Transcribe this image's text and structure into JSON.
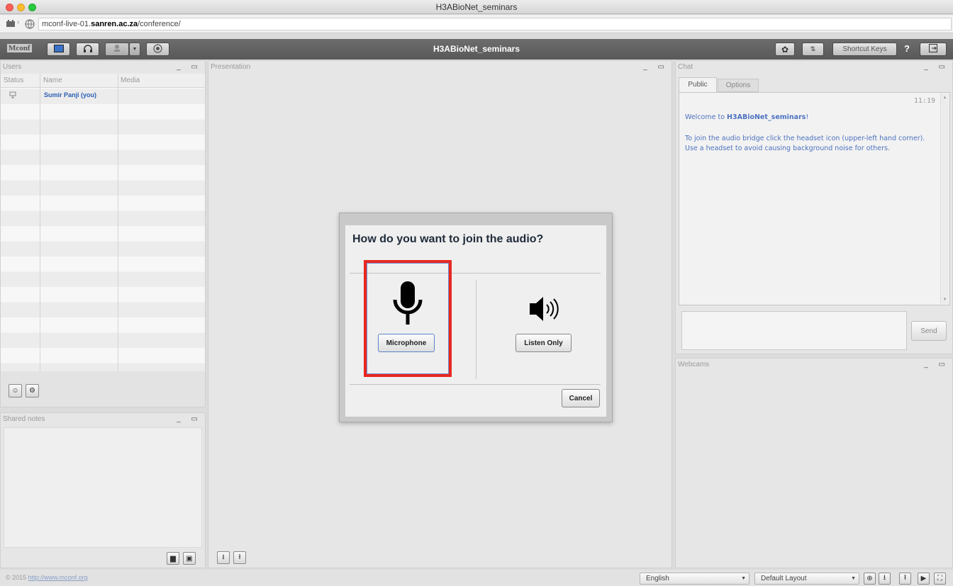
{
  "window": {
    "title": "H3ABioNet_seminars"
  },
  "browser": {
    "url_prefix": "mconf-live-01.",
    "url_bold": "sanren.ac.za",
    "url_suffix": "/conference/"
  },
  "toolbar": {
    "logo": "Mconf",
    "title": "H3ABioNet_seminars",
    "shortcut_keys": "Shortcut Keys",
    "help": "?",
    "icons": [
      "presentation-icon",
      "headset-icon",
      "webcam-icon",
      "record-icon",
      "settings-icon",
      "network-icon",
      "logout-icon"
    ]
  },
  "users": {
    "title": "Users",
    "columns": [
      "Status",
      "Name",
      "Media"
    ],
    "rows": [
      {
        "name": "Sumir Panji (you)",
        "status_icon": "presenter-icon"
      }
    ]
  },
  "shared_notes": {
    "title": "Shared notes"
  },
  "presentation": {
    "title": "Presentation"
  },
  "chat": {
    "title": "Chat",
    "tabs": [
      "Public",
      "Options"
    ],
    "time": "11:19",
    "welcome_prefix": "Welcome to ",
    "welcome_room": "H3ABioNet_seminars",
    "welcome_suffix": "!",
    "help_text": "To join the audio bridge click the headset icon (upper-left hand corner). Use a headset to avoid causing background noise for others.",
    "send": "Send"
  },
  "webcams": {
    "title": "Webcams"
  },
  "modal": {
    "title": "How do you want to join the audio?",
    "microphone": "Microphone",
    "listen_only": "Listen Only",
    "cancel": "Cancel",
    "highlight_color": "#e8281f"
  },
  "footer": {
    "copyright": "© 2015 ",
    "link": "http://www.mconf.org",
    "language": "English",
    "layout": "Default Layout"
  }
}
